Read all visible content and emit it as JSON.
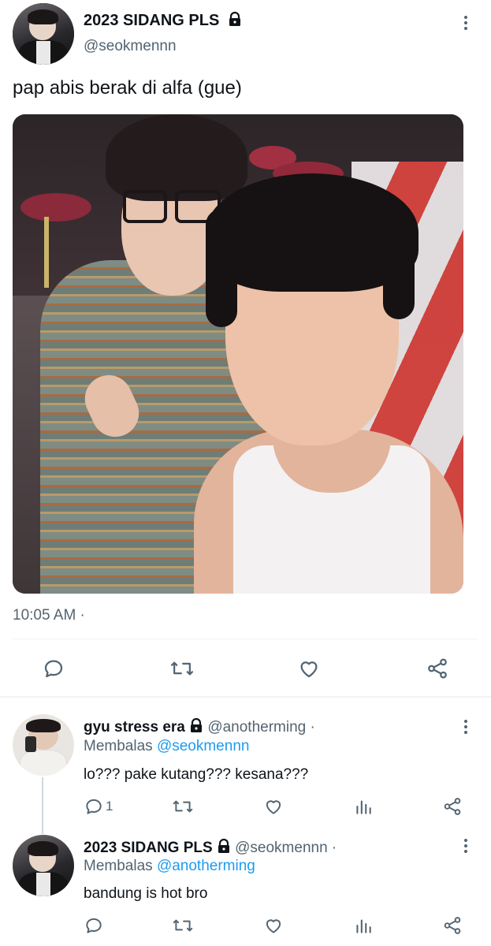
{
  "tweet": {
    "author": {
      "name": "2023 SIDANG PLS",
      "handle": "@seokmennn"
    },
    "text": "pap abis berak di alfa (gue)",
    "timestamp": "10:05 AM ·"
  },
  "replies": [
    {
      "author": {
        "name": "gyu stress era",
        "handle": "@anotherming ·"
      },
      "replying_label": "Membalas",
      "replying_to": "@seokmennn",
      "text": "lo??? pake kutang??? kesana???",
      "reply_count": "1"
    },
    {
      "author": {
        "name": "2023 SIDANG PLS",
        "handle": "@seokmennn ·"
      },
      "replying_label": "Membalas",
      "replying_to": "@anotherming",
      "text": "bandung is hot bro",
      "reply_count": ""
    }
  ],
  "icons": {
    "reply": "reply-bubble-icon",
    "retweet": "retweet-icon",
    "like": "heart-icon",
    "views": "views-bar-icon",
    "share": "share-icon",
    "lock": "lock-icon",
    "more": "more-vertical-icon"
  },
  "colors": {
    "text": "#0f1419",
    "secondary": "#536471",
    "link": "#1d9bf0",
    "divider": "#eff3f4"
  }
}
